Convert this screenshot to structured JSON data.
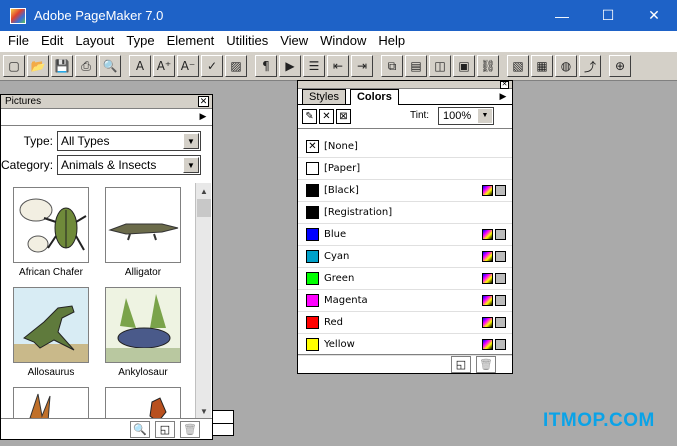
{
  "window": {
    "title": "Adobe PageMaker 7.0",
    "minimize": "—",
    "maximize": "☐",
    "close": "✕"
  },
  "menu": [
    "File",
    "Edit",
    "Layout",
    "Type",
    "Element",
    "Utilities",
    "View",
    "Window",
    "Help"
  ],
  "toolbar": {
    "icons": [
      "new-icon",
      "open-icon",
      "save-icon",
      "print-icon",
      "find-icon",
      "sep",
      "font-icon",
      "font-size-up-icon",
      "font-size-down-icon",
      "spell-check-icon",
      "fill-icon",
      "sep",
      "paragraph-icon",
      "threading-icon",
      "bullets-icon",
      "indent-left-icon",
      "indent-right-icon",
      "sep",
      "copy-icon",
      "paste-icon",
      "frame-icon",
      "image-icon",
      "link-icon",
      "sep",
      "color-icon",
      "picture-icon",
      "globe-icon",
      "export-icon",
      "sep",
      "add-icon"
    ],
    "glyphs": [
      "▢",
      "📂",
      "💾",
      "⎙",
      "🔍",
      "",
      "A",
      "A⁺",
      "A⁻",
      "✓",
      "▨",
      "",
      "¶",
      "▶",
      "☰",
      "⇤",
      "⇥",
      "",
      "⧉",
      "▤",
      "◫",
      "▣",
      "⛓",
      "",
      "▧",
      "▦",
      "◍",
      "⤴",
      "",
      "⊕"
    ]
  },
  "pictures": {
    "title": "Pictures",
    "type_label": "Type:",
    "type_value": "All Types",
    "category_label": "Category:",
    "category_value": "Animals & Insects",
    "items": [
      "African Chafer",
      "Alligator",
      "Allosaurus",
      "Ankylosaur"
    ],
    "footer_icons": {
      "search": "🔍",
      "new": "◱",
      "trash": "🗑"
    }
  },
  "colors": {
    "tabs": [
      "Styles",
      "Colors"
    ],
    "active_tab": "Colors",
    "tint_label": "Tint:",
    "tint_value": "100%",
    "swatches": [
      {
        "name": "[None]",
        "color": "#ffffff",
        "none": true,
        "icons": false
      },
      {
        "name": "[Paper]",
        "color": "#ffffff",
        "icons": false
      },
      {
        "name": "[Black]",
        "color": "#000000",
        "icons": true
      },
      {
        "name": "[Registration]",
        "color": "#000000",
        "icons": false
      },
      {
        "name": "Blue",
        "color": "#0000ff",
        "icons": true
      },
      {
        "name": "Cyan",
        "color": "#00a0c8",
        "icons": true
      },
      {
        "name": "Green",
        "color": "#00ff00",
        "icons": true
      },
      {
        "name": "Magenta",
        "color": "#ff00ff",
        "icons": true
      },
      {
        "name": "Red",
        "color": "#ff0000",
        "icons": true
      },
      {
        "name": "Yellow",
        "color": "#ffff00",
        "icons": true
      }
    ]
  },
  "watermark": "ITMOP.COM"
}
